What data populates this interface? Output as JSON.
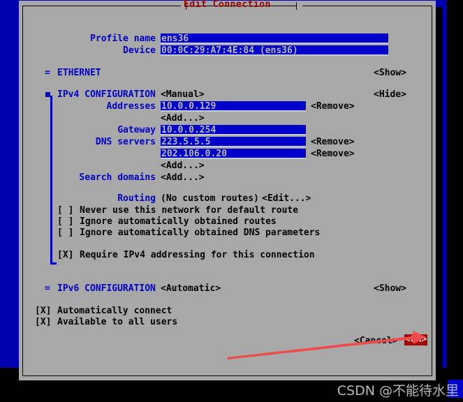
{
  "window": {
    "title": "Edit Connection",
    "title_color": "#a00000",
    "background_color": "#a8a8a8",
    "terminal_color": "#0000b0",
    "field_color": "#0000c8",
    "accent_color": "#a80000"
  },
  "form": {
    "profile_name": {
      "label": "Profile name",
      "value": "ens36"
    },
    "device": {
      "label": "Device",
      "value": "00:0C:29:A7:4E:84 (ens36)"
    }
  },
  "ethernet": {
    "marker": "=",
    "label": "ETHERNET",
    "toggle": "<Show>"
  },
  "ipv4": {
    "marker": "square",
    "label": "IPv4 CONFIGURATION",
    "mode": "<Manual>",
    "toggle": "<Hide>",
    "addresses": {
      "label": "Addresses",
      "items": [
        {
          "value": "10.0.0.129",
          "remove": "<Remove>"
        }
      ],
      "add": "<Add...>"
    },
    "gateway": {
      "label": "Gateway",
      "value": "10.0.0.254"
    },
    "dns": {
      "label": "DNS servers",
      "items": [
        {
          "value": "223.5.5.5",
          "remove": "<Remove>"
        },
        {
          "value": "202.106.0.20",
          "remove": "<Remove>"
        }
      ],
      "add": "<Add...>"
    },
    "search_domains": {
      "label": "Search domains",
      "add": "<Add...>"
    },
    "routing": {
      "label": "Routing",
      "status": "(No custom routes)",
      "edit": "<Edit...>"
    },
    "checkboxes": [
      {
        "box": "[ ]",
        "checked": false,
        "label": "Never use this network for default route"
      },
      {
        "box": "[ ]",
        "checked": false,
        "label": "Ignore automatically obtained routes"
      },
      {
        "box": "[ ]",
        "checked": false,
        "label": "Ignore automatically obtained DNS parameters"
      },
      {
        "box": "[X]",
        "checked": true,
        "label": "Require IPv4 addressing for this connection"
      }
    ]
  },
  "ipv6": {
    "marker": "=",
    "label": "IPv6 CONFIGURATION",
    "mode": "<Automatic>",
    "toggle": "<Show>"
  },
  "options": [
    {
      "box": "[X]",
      "checked": true,
      "label": "Automatically connect"
    },
    {
      "box": "[X]",
      "checked": true,
      "label": "Available to all users"
    }
  ],
  "actions": {
    "cancel": "<Cancel>",
    "ok": "<OK>"
  },
  "annotation": {
    "arrow_color": "#f04040",
    "points_to": "ok-button"
  },
  "watermark": {
    "text": "CSDN @不能待水里"
  }
}
